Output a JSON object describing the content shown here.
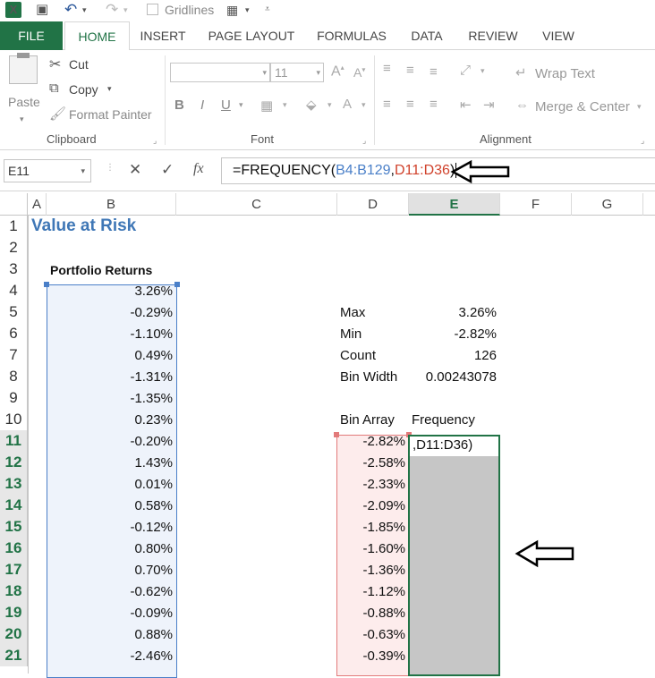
{
  "qat": {
    "logo": "X",
    "gridlines_label": "Gridlines",
    "icons": [
      "save-icon",
      "undo-icon",
      "redo-icon",
      "table-icon",
      "customize-icon"
    ]
  },
  "tabs": [
    "FILE",
    "HOME",
    "INSERT",
    "PAGE LAYOUT",
    "FORMULAS",
    "DATA",
    "REVIEW",
    "VIEW"
  ],
  "ribbon": {
    "clipboard": {
      "paste": "Paste",
      "cut": "Cut",
      "copy": "Copy",
      "format_painter": "Format Painter",
      "label": "Clipboard"
    },
    "font": {
      "size": "11",
      "label": "Font",
      "bold": "B",
      "italic": "I",
      "underline": "U"
    },
    "alignment": {
      "wrap_text": "Wrap Text",
      "merge_center": "Merge & Center",
      "label": "Alignment"
    }
  },
  "formula_bar": {
    "name_box": "E11",
    "cancel": "✕",
    "enter": "✓",
    "fx": "fx",
    "prefix": "=FREQUENCY(",
    "ref1": "B4:B129",
    "comma": ",",
    "ref2": "D11:D36",
    "suffix": ")"
  },
  "columns": [
    "A",
    "B",
    "C",
    "D",
    "E",
    "F",
    "G"
  ],
  "rows": [
    "1",
    "2",
    "3",
    "4",
    "5",
    "6",
    "7",
    "8",
    "9",
    "10",
    "11",
    "12",
    "13",
    "14",
    "15",
    "16",
    "17",
    "18",
    "19",
    "20",
    "21"
  ],
  "sheet": {
    "title": "Value at Risk",
    "returns_header": "Portfolio Returns",
    "returns": [
      "3.26%",
      "-0.29%",
      "-1.10%",
      "0.49%",
      "-1.31%",
      "-1.35%",
      "0.23%",
      "-0.20%",
      "1.43%",
      "0.01%",
      "0.58%",
      "-0.12%",
      "0.80%",
      "0.70%",
      "-0.62%",
      "-0.09%",
      "0.88%",
      "-2.46%"
    ],
    "stats": [
      {
        "label": "Max",
        "value": "3.26%"
      },
      {
        "label": "Min",
        "value": "-2.82%"
      },
      {
        "label": "Count",
        "value": "126"
      },
      {
        "label": "Bin Width",
        "value": "0.00243078"
      }
    ],
    "bin_header": "Bin Array",
    "freq_header": "Frequency",
    "bins": [
      "-2.82%",
      "-2.58%",
      "-2.33%",
      "-2.09%",
      "-1.85%",
      "-1.60%",
      "-1.36%",
      "-1.12%",
      "-0.88%",
      "-0.63%",
      "-0.39%"
    ],
    "edit_text": ",D11:D36)"
  }
}
